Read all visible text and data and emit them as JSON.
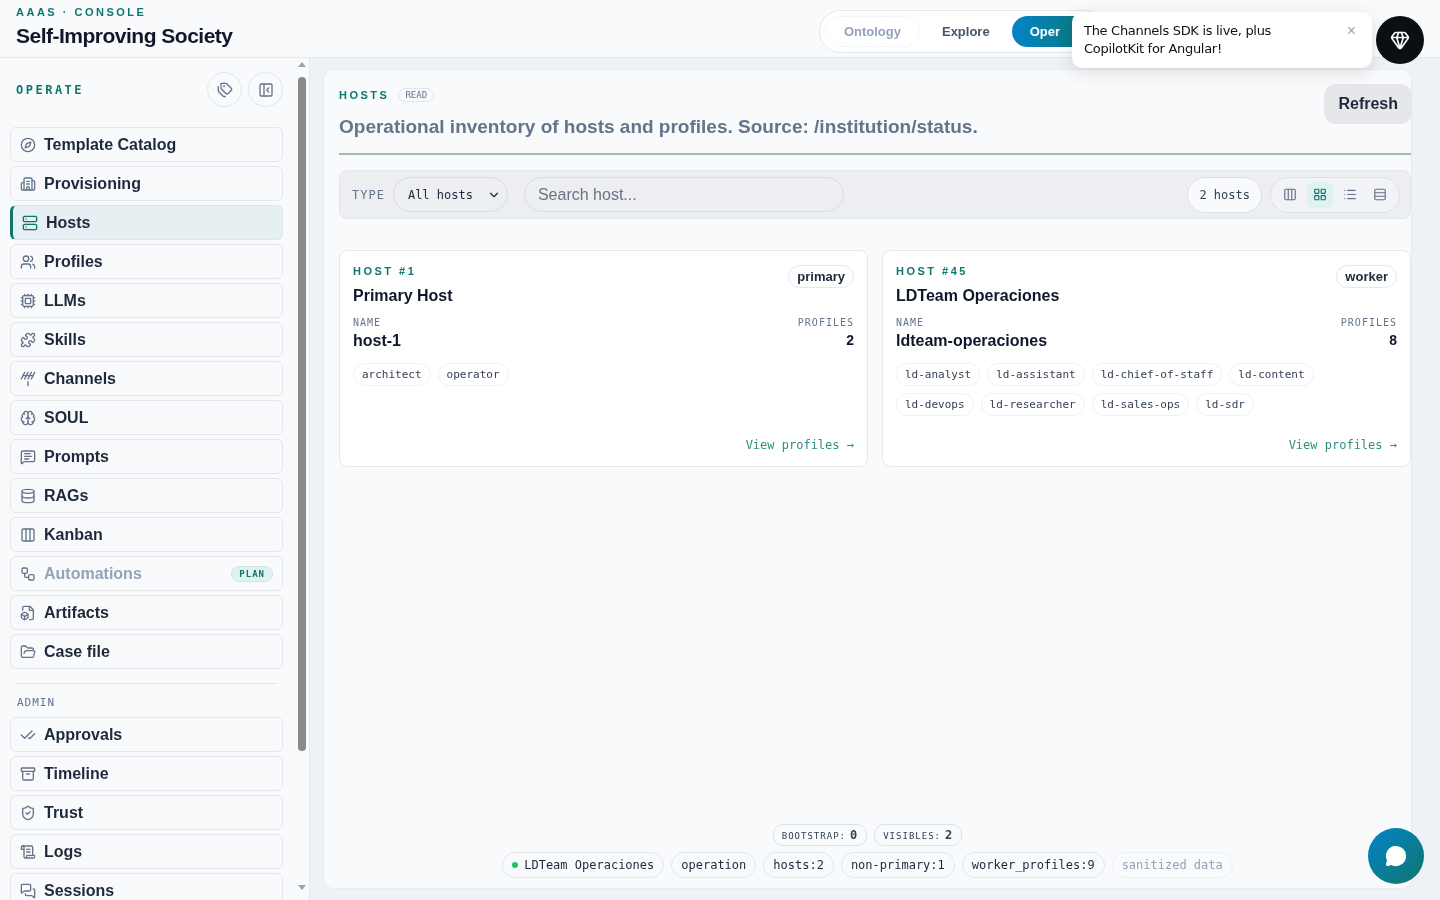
{
  "header": {
    "eyebrow": "AAAS · CONSOLE",
    "title": "Self-Improving Society"
  },
  "nav_tabs": [
    {
      "label": "Ontology",
      "selected": false,
      "disabled": true
    },
    {
      "label": "Explore",
      "selected": false,
      "disabled": false
    },
    {
      "label": "Oper",
      "selected": true,
      "disabled": false
    }
  ],
  "toast": {
    "message": "The Channels SDK is live, plus CopilotKit for Angular!",
    "close": "×"
  },
  "sidebar": {
    "section": "OPERATE",
    "items": [
      {
        "label": "Template Catalog",
        "selected": false,
        "disabled": false
      },
      {
        "label": "Provisioning",
        "selected": false,
        "disabled": false
      },
      {
        "label": "Hosts",
        "selected": true,
        "disabled": false
      },
      {
        "label": "Profiles",
        "selected": false,
        "disabled": false
      },
      {
        "label": "LLMs",
        "selected": false,
        "disabled": false
      },
      {
        "label": "Skills",
        "selected": false,
        "disabled": false
      },
      {
        "label": "Channels",
        "selected": false,
        "disabled": false
      },
      {
        "label": "SOUL",
        "selected": false,
        "disabled": false
      },
      {
        "label": "Prompts",
        "selected": false,
        "disabled": false
      },
      {
        "label": "RAGs",
        "selected": false,
        "disabled": false
      },
      {
        "label": "Kanban",
        "selected": false,
        "disabled": false
      },
      {
        "label": "Automations",
        "selected": false,
        "disabled": true,
        "badge": "PLAN"
      },
      {
        "label": "Artifacts",
        "selected": false,
        "disabled": false
      },
      {
        "label": "Case file",
        "selected": false,
        "disabled": false
      }
    ],
    "admin_section": "ADMIN",
    "admin_items": [
      {
        "label": "Approvals",
        "selected": false,
        "disabled": false
      },
      {
        "label": "Timeline",
        "selected": false,
        "disabled": false
      },
      {
        "label": "Trust",
        "selected": false,
        "disabled": false
      },
      {
        "label": "Logs",
        "selected": false,
        "disabled": false
      },
      {
        "label": "Sessions",
        "selected": false,
        "disabled": false
      }
    ]
  },
  "panel": {
    "eyebrow": "HOSTS",
    "mode": "READ",
    "description": "Operational inventory of hosts and profiles. Source: /institution/status.",
    "refresh": "Refresh"
  },
  "filters": {
    "type_label": "TYPE",
    "type_value": "All hosts",
    "search_placeholder": "Search host...",
    "count": "2 hosts",
    "views": [
      {
        "selected": false
      },
      {
        "selected": true
      },
      {
        "selected": false
      },
      {
        "selected": false
      }
    ]
  },
  "hosts": [
    {
      "number": "HOST #1",
      "title": "Primary Host",
      "role": "primary",
      "name_label": "NAME",
      "name": "host-1",
      "profiles_label": "PROFILES",
      "profiles": "2",
      "tags": [
        "architect",
        "operator"
      ],
      "link": "View profiles →"
    },
    {
      "number": "HOST #45",
      "title": "LDTeam Operaciones",
      "role": "worker",
      "name_label": "NAME",
      "name": "ldteam-operaciones",
      "profiles_label": "PROFILES",
      "profiles": "8",
      "tags": [
        "ld-analyst",
        "ld-assistant",
        "ld-chief-of-staff",
        "ld-content",
        "ld-devops",
        "ld-researcher",
        "ld-sales-ops",
        "ld-sdr"
      ],
      "link": "View profiles →"
    }
  ],
  "footer": {
    "counters": [
      {
        "label": "BOOTSTRAP:",
        "value": "0"
      },
      {
        "label": "VISIBLES:",
        "value": "2"
      }
    ],
    "chips": [
      {
        "text": "LDTeam Operaciones",
        "dot": true,
        "muted": false
      },
      {
        "text": "operation",
        "dot": false,
        "muted": false
      },
      {
        "text": "hosts:2",
        "dot": false,
        "muted": false
      },
      {
        "text": "non-primary:1",
        "dot": false,
        "muted": false
      },
      {
        "text": "worker_profiles:9",
        "dot": false,
        "muted": false
      },
      {
        "text": "sanitized data",
        "dot": false,
        "muted": true
      }
    ]
  }
}
